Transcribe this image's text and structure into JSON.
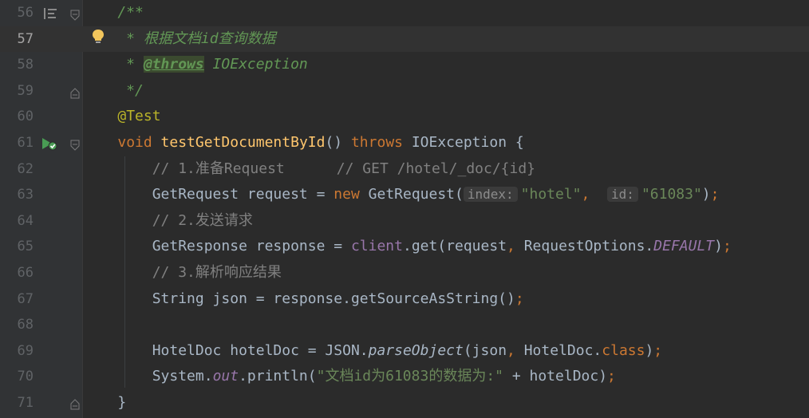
{
  "lines": [
    {
      "no": "56",
      "parts": [
        {
          "t": "    /**",
          "c": "c-doc"
        }
      ]
    },
    {
      "no": "57",
      "parts": [
        {
          "t": "     * 根据文档id查询数据",
          "c": "c-doc"
        }
      ]
    },
    {
      "no": "58",
      "parts": [
        {
          "t": "     * ",
          "c": "c-doc"
        },
        {
          "t": "@throws",
          "c": "c-tag"
        },
        {
          "t": " IOException",
          "c": "c-doc"
        }
      ]
    },
    {
      "no": "59",
      "parts": [
        {
          "t": "     */",
          "c": "c-doc"
        }
      ]
    },
    {
      "no": "60",
      "parts": [
        {
          "t": "    ",
          "c": ""
        },
        {
          "t": "@Test",
          "c": "c-ann"
        }
      ]
    },
    {
      "no": "61",
      "parts": [
        {
          "t": "    ",
          "c": ""
        },
        {
          "t": "void ",
          "c": "c-kw"
        },
        {
          "t": "testGetDocumentById",
          "c": "c-fn"
        },
        {
          "t": "() ",
          "c": ""
        },
        {
          "t": "throws ",
          "c": "c-kw"
        },
        {
          "t": "IOException {",
          "c": ""
        }
      ]
    },
    {
      "no": "62",
      "parts": [
        {
          "t": "        // 1.准备Request      // GET /hotel/_doc/{id}",
          "c": "c-line"
        }
      ]
    },
    {
      "no": "63",
      "parts": [
        {
          "t": "        GetRequest request = ",
          "c": ""
        },
        {
          "t": "new ",
          "c": "c-kw"
        },
        {
          "t": "GetRequest(",
          "c": ""
        },
        {
          "t": "index:",
          "c": "hint"
        },
        {
          "t": "\"hotel\"",
          "c": "c-str"
        },
        {
          "t": ",  ",
          "c": "c-kw"
        },
        {
          "t": "id:",
          "c": "hint"
        },
        {
          "t": "\"61083\"",
          "c": "c-str"
        },
        {
          "t": ")",
          "c": ""
        },
        {
          "t": ";",
          "c": "c-kw"
        }
      ]
    },
    {
      "no": "64",
      "parts": [
        {
          "t": "        // 2.发送请求",
          "c": "c-line"
        }
      ]
    },
    {
      "no": "65",
      "parts": [
        {
          "t": "        GetResponse response = ",
          "c": ""
        },
        {
          "t": "client",
          "c": "c-field"
        },
        {
          "t": ".get(request",
          "c": ""
        },
        {
          "t": ", ",
          "c": "c-kw"
        },
        {
          "t": "RequestOptions.",
          "c": ""
        },
        {
          "t": "DEFAULT",
          "c": "c-static"
        },
        {
          "t": ")",
          "c": ""
        },
        {
          "t": ";",
          "c": "c-kw"
        }
      ]
    },
    {
      "no": "66",
      "parts": [
        {
          "t": "        // 3.解析响应结果",
          "c": "c-line"
        }
      ]
    },
    {
      "no": "67",
      "parts": [
        {
          "t": "        String json = response.getSourceAsString()",
          "c": ""
        },
        {
          "t": ";",
          "c": "c-kw"
        }
      ]
    },
    {
      "no": "68",
      "parts": []
    },
    {
      "no": "69",
      "parts": [
        {
          "t": "        HotelDoc hotelDoc = JSON.",
          "c": ""
        },
        {
          "t": "parseObject",
          "c": "c-italic"
        },
        {
          "t": "(json",
          "c": ""
        },
        {
          "t": ", ",
          "c": "c-kw"
        },
        {
          "t": "HotelDoc.",
          "c": ""
        },
        {
          "t": "class",
          "c": "c-kw"
        },
        {
          "t": ")",
          "c": ""
        },
        {
          "t": ";",
          "c": "c-kw"
        }
      ]
    },
    {
      "no": "70",
      "parts": [
        {
          "t": "        System.",
          "c": ""
        },
        {
          "t": "out",
          "c": "c-static"
        },
        {
          "t": ".println(",
          "c": ""
        },
        {
          "t": "\"文档id为61083的数据为:\"",
          "c": "c-str"
        },
        {
          "t": " + hotelDoc)",
          "c": ""
        },
        {
          "t": ";",
          "c": "c-kw"
        }
      ]
    },
    {
      "no": "71",
      "parts": [
        {
          "t": "    }",
          "c": ""
        }
      ]
    }
  ],
  "current_line": "57",
  "gutter_icons": {
    "56": "doc-comment-render-icon",
    "57": "lightbulb-icon",
    "61": "run-test-icon"
  },
  "colors": {
    "background": "#2b2b2b",
    "gutter": "#313335",
    "keyword": "#cc7832",
    "string": "#6a8759",
    "doc_comment": "#629755",
    "annotation": "#bbb529",
    "method": "#ffc66d"
  }
}
